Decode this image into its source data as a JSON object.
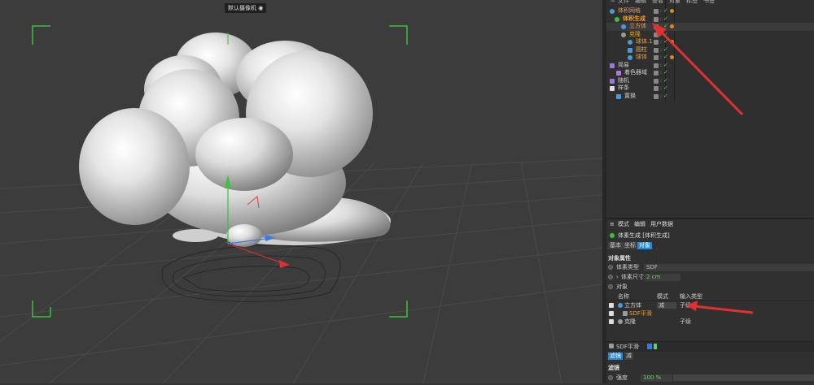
{
  "viewport": {
    "camera_label": "默认摄像机"
  },
  "object_manager": {
    "menu": [
      "文件",
      "编辑",
      "查看",
      "对象",
      "标签",
      "书签"
    ],
    "tree": [
      {
        "label": "体积网格",
        "color": "orange"
      },
      {
        "label": "体积生成",
        "color": "orange",
        "bold": true
      },
      {
        "label": "立方体",
        "color": "orange"
      },
      {
        "label": "克隆",
        "color": "orange"
      },
      {
        "label": "球体.1",
        "color": "orange"
      },
      {
        "label": "圆柱",
        "color": "orange"
      },
      {
        "label": "球体",
        "color": "orange"
      },
      {
        "label": "简易",
        "color": "normal"
      },
      {
        "label": "着色器域",
        "color": "normal"
      },
      {
        "label": "随机",
        "color": "normal"
      },
      {
        "label": "样条",
        "color": "normal"
      },
      {
        "label": "置换",
        "color": "normal"
      }
    ]
  },
  "attribute_manager": {
    "menu": [
      "模式",
      "编辑",
      "用户数据"
    ],
    "object_title": "体素生成 [体积生成]",
    "tabs": [
      "基本",
      "坐标",
      "对象"
    ],
    "active_tab": "对象",
    "section_title": "对象属性",
    "voxel_type_label": "体素类型",
    "voxel_type_value": "SDF",
    "voxel_size_label": "体素尺寸",
    "voxel_size_value": "2 cm",
    "objects_label": "对象",
    "table_headers": {
      "name": "名称",
      "mode": "模式",
      "input_type": "输入类型"
    },
    "table_rows": [
      {
        "name": "立方体",
        "mode": "减",
        "input_type": "子级"
      },
      {
        "name": "SDF平滑",
        "mode": "",
        "input_type": ""
      },
      {
        "name": "克隆",
        "mode": "",
        "input_type": "子级"
      }
    ],
    "filter_name": "SDF平滑",
    "filter_tabs": [
      "滤镜",
      "减"
    ],
    "filter_section": "滤镜",
    "strength_label": "强度",
    "strength_value": "100 %"
  },
  "colors": {
    "accent": "#2d86c8",
    "orange": "#f0a030",
    "arrow": "#e03030",
    "check": "#5fd35f"
  }
}
